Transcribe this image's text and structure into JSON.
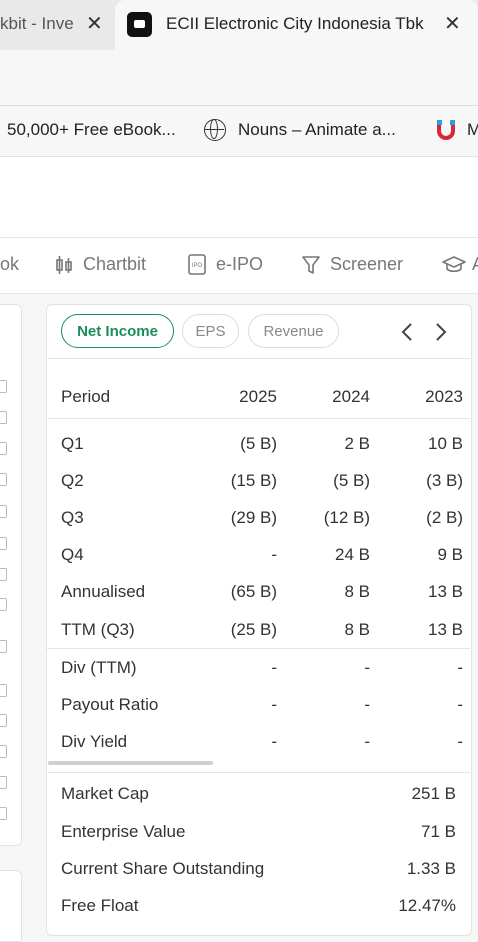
{
  "tabs": {
    "prev": {
      "title": "kbit - Inve"
    },
    "active": {
      "title": "ECII Electronic City Indonesia Tbk"
    }
  },
  "bookmarks": [
    {
      "label": "50,000+ Free eBook..."
    },
    {
      "label": "Nouns – Animate a..."
    },
    {
      "label": "M"
    }
  ],
  "nav": {
    "items": [
      {
        "label": "ok"
      },
      {
        "label": "Chartbit",
        "icon": "candlestick-icon"
      },
      {
        "label": "e-IPO",
        "icon": "ipo-icon"
      },
      {
        "label": "Screener",
        "icon": "filter-icon"
      },
      {
        "label": "A",
        "icon": "graduation-cap-icon"
      }
    ]
  },
  "financials": {
    "tabs": [
      "Net Income",
      "EPS",
      "Revenue"
    ],
    "active_tab": "Net Income",
    "columns": [
      "Period",
      "2025",
      "2024",
      "2023"
    ],
    "rows": [
      {
        "period": "Q1",
        "y2025": "(5 B)",
        "y2024": "2 B",
        "y2023": "10 B"
      },
      {
        "period": "Q2",
        "y2025": "(15 B)",
        "y2024": "(5 B)",
        "y2023": "(3 B)"
      },
      {
        "period": "Q3",
        "y2025": "(29 B)",
        "y2024": "(12 B)",
        "y2023": "(2 B)"
      },
      {
        "period": "Q4",
        "y2025": "-",
        "y2024": "24 B",
        "y2023": "9 B"
      },
      {
        "period": "Annualised",
        "y2025": "(65 B)",
        "y2024": "8 B",
        "y2023": "13 B"
      },
      {
        "period": "TTM (Q3)",
        "y2025": "(25 B)",
        "y2024": "8 B",
        "y2023": "13 B"
      }
    ],
    "div_rows": [
      {
        "period": "Div (TTM)",
        "y2025": "-",
        "y2024": "-",
        "y2023": "-"
      },
      {
        "period": "Payout Ratio",
        "y2025": "-",
        "y2024": "-",
        "y2023": "-"
      },
      {
        "period": "Div Yield",
        "y2025": "-",
        "y2024": "-",
        "y2023": "-"
      }
    ]
  },
  "stats": [
    {
      "label": "Market Cap",
      "value": "251 B"
    },
    {
      "label": "Enterprise Value",
      "value": "71 B"
    },
    {
      "label": "Current Share Outstanding",
      "value": "1.33 B"
    },
    {
      "label": "Free Float",
      "value": "12.47%"
    }
  ],
  "colors": {
    "accent": "#1a8f5e"
  }
}
